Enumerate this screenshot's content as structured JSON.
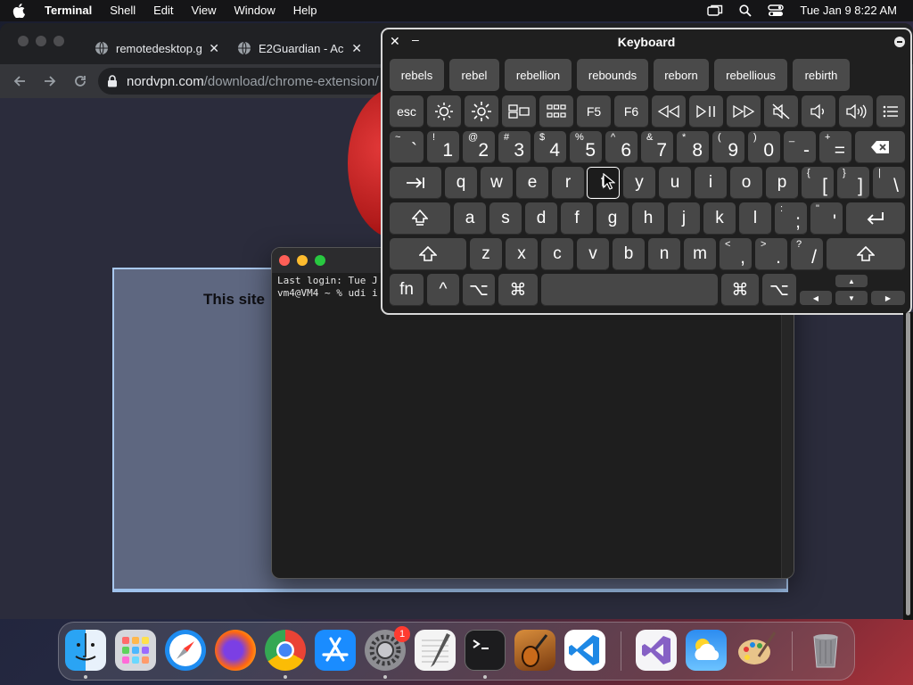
{
  "menubar": {
    "app_name": "Terminal",
    "items": [
      "Shell",
      "Edit",
      "View",
      "Window",
      "Help"
    ],
    "clock": "Tue Jan 9  8:22 AM",
    "icons": [
      "apple-icon",
      "screen-mirroring-icon",
      "spotlight-search-icon",
      "control-center-icon"
    ]
  },
  "browser": {
    "tabs": [
      {
        "title": "remotedesktop.g",
        "icon": "globe-icon"
      },
      {
        "title": "E2Guardian - Acc",
        "icon": "globe-icon"
      }
    ],
    "url_host": "nordvpn.com",
    "url_path": "/download/chrome-extension/",
    "page_text": "This site"
  },
  "terminal": {
    "lines": [
      "Last login: Tue J",
      "vm4@VM4 ~ % udi i"
    ]
  },
  "keyboard": {
    "title": "Keyboard",
    "suggestions": [
      "rebels",
      "rebel",
      "rebellion",
      "rebounds",
      "reborn",
      "rebellious",
      "rebirth"
    ],
    "fn_row": {
      "esc": "esc",
      "f5": "F5",
      "f6": "F6"
    },
    "number_row": [
      {
        "shift": "~",
        "main": "`"
      },
      {
        "shift": "!",
        "main": "1"
      },
      {
        "shift": "@",
        "main": "2"
      },
      {
        "shift": "#",
        "main": "3"
      },
      {
        "shift": "$",
        "main": "4"
      },
      {
        "shift": "%",
        "main": "5"
      },
      {
        "shift": "^",
        "main": "6"
      },
      {
        "shift": "&",
        "main": "7"
      },
      {
        "shift": "*",
        "main": "8"
      },
      {
        "shift": "(",
        "main": "9"
      },
      {
        "shift": ")",
        "main": "0"
      },
      {
        "shift": "_",
        "main": "-"
      },
      {
        "shift": "+",
        "main": "="
      }
    ],
    "row_q": [
      "q",
      "w",
      "e",
      "r",
      "t",
      "y",
      "u",
      "i",
      "o",
      "p"
    ],
    "row_q_sym": [
      {
        "shift": "{",
        "main": "["
      },
      {
        "shift": "}",
        "main": "]"
      },
      {
        "shift": "|",
        "main": "\\"
      }
    ],
    "row_a": [
      "a",
      "s",
      "d",
      "f",
      "g",
      "h",
      "j",
      "k",
      "l"
    ],
    "row_a_sym": [
      {
        "shift": ":",
        "main": ";"
      },
      {
        "shift": "\"",
        "main": "'"
      }
    ],
    "row_z": [
      "z",
      "x",
      "c",
      "v",
      "b",
      "n",
      "m"
    ],
    "row_z_sym": [
      {
        "shift": "<",
        "main": ","
      },
      {
        "shift": ">",
        "main": "."
      },
      {
        "shift": "?",
        "main": "/"
      }
    ],
    "bottom": {
      "fn": "fn",
      "control": "^",
      "option": "⌥",
      "command": "⌘"
    },
    "pressed_key": "t"
  },
  "dock": {
    "apps": [
      "Finder",
      "Launchpad",
      "Safari",
      "Firefox",
      "Google Chrome",
      "App Store",
      "System Settings",
      "TextEdit",
      "Terminal",
      "GarageBand",
      "Visual Studio Code",
      "Visual Studio",
      "Weather",
      "Paintbrush",
      "Trash"
    ],
    "system_settings_badge": "1"
  }
}
